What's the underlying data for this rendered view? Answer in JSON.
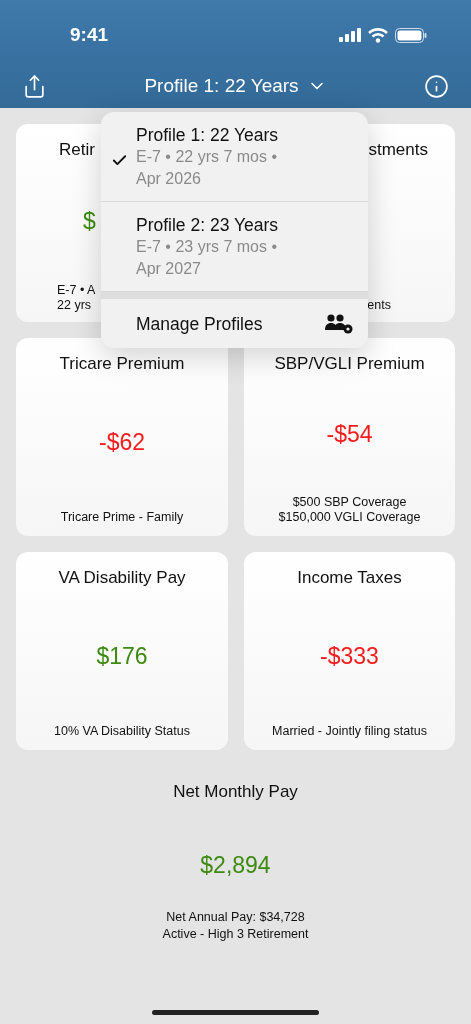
{
  "status_bar": {
    "time": "9:41"
  },
  "nav": {
    "title": "Profile 1: 22 Years"
  },
  "cards": [
    {
      "kind": "covered-right",
      "title": "Retir",
      "value": "$",
      "color": "#3d8a10",
      "footer": [
        "E-7 • A",
        "22 yrs"
      ]
    },
    {
      "kind": "covered-left",
      "title": "stments",
      "footer": [
        "ents"
      ]
    },
    {
      "kind": "full",
      "title": "Tricare Premium",
      "value": "-$62",
      "color": "#f41c1c",
      "footer": [
        "Tricare Prime - Family"
      ]
    },
    {
      "kind": "full",
      "title": "SBP/VGLI Premium",
      "value": "-$54",
      "color": "#f41c1c",
      "footer": [
        "$500 SBP Coverage",
        "$150,000 VGLI Coverage"
      ]
    },
    {
      "kind": "full",
      "title": "VA Disability Pay",
      "value": "$176",
      "color": "#3d8a10",
      "footer": [
        "10% VA Disability Status"
      ]
    },
    {
      "kind": "full",
      "title": "Income Taxes",
      "value": "-$333",
      "color": "#f41c1c",
      "footer": [
        "Married - Jointly filing status"
      ]
    }
  ],
  "summary": {
    "title": "Net Monthly Pay",
    "value": "$2,894",
    "color": "#3d8a10",
    "lines": [
      "Net Annual Pay: $34,728",
      "Active - High 3 Retirement"
    ]
  },
  "menu": {
    "items": [
      {
        "title": "Profile 1: 22 Years",
        "detail": "E-7 • 22 yrs 7 mos • Apr 2026",
        "selected": true
      },
      {
        "title": "Profile 2: 23 Years",
        "detail": "E-7 • 23 yrs 7 mos • Apr 2027",
        "selected": false
      }
    ],
    "manage": {
      "label": "Manage Profiles"
    }
  }
}
